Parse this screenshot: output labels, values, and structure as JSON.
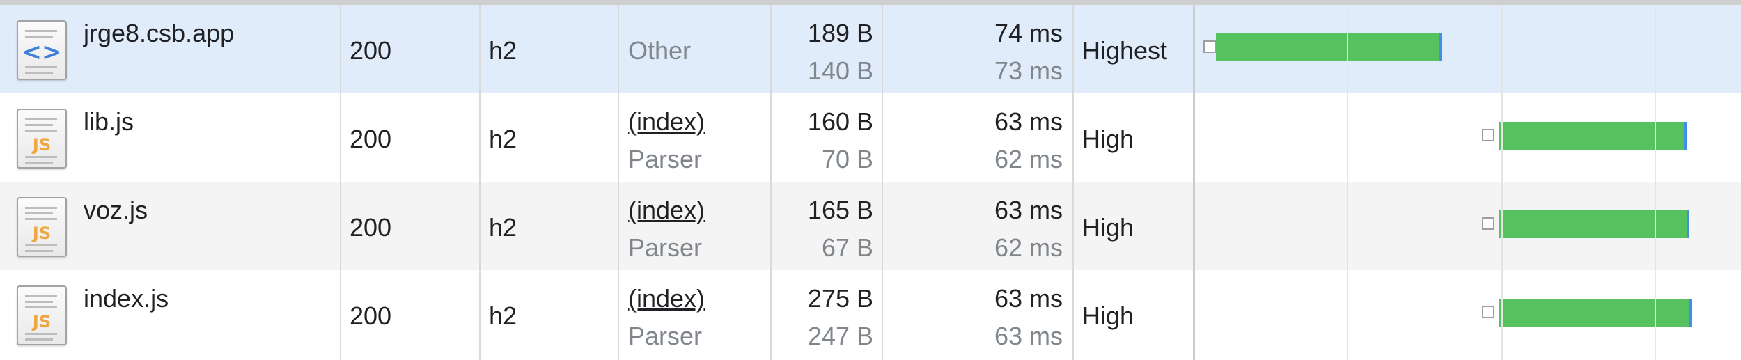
{
  "colors": {
    "selected_row": "#e1ecfb",
    "bar": "#56c25f",
    "bar_tail": "#3f8ee8"
  },
  "rows": [
    {
      "name": "jrge8.csb.app",
      "icon": "document-html-icon",
      "icon_glyph": "<>",
      "status": "200",
      "protocol": "h2",
      "initiator": "Other",
      "initiator_sub": "",
      "size": "189 B",
      "size_sub": "140 B",
      "time": "74 ms",
      "time_sub": "73 ms",
      "priority": "Highest",
      "selected": true
    },
    {
      "name": "lib.js",
      "icon": "script-js-icon",
      "icon_glyph": "JS",
      "status": "200",
      "protocol": "h2",
      "initiator": "(index)",
      "initiator_sub": "Parser",
      "size": "160 B",
      "size_sub": "70 B",
      "time": "63 ms",
      "time_sub": "62 ms",
      "priority": "High",
      "selected": false
    },
    {
      "name": "voz.js",
      "icon": "script-js-icon",
      "icon_glyph": "JS",
      "status": "200",
      "protocol": "h2",
      "initiator": "(index)",
      "initiator_sub": "Parser",
      "size": "165 B",
      "size_sub": "67 B",
      "time": "63 ms",
      "time_sub": "62 ms",
      "priority": "High",
      "selected": false
    },
    {
      "name": "index.js",
      "icon": "script-js-icon",
      "icon_glyph": "JS",
      "status": "200",
      "protocol": "h2",
      "initiator": "(index)",
      "initiator_sub": "Parser",
      "size": "275 B",
      "size_sub": "247 B",
      "time": "63 ms",
      "time_sub": "63 ms",
      "priority": "High",
      "selected": false
    }
  ]
}
